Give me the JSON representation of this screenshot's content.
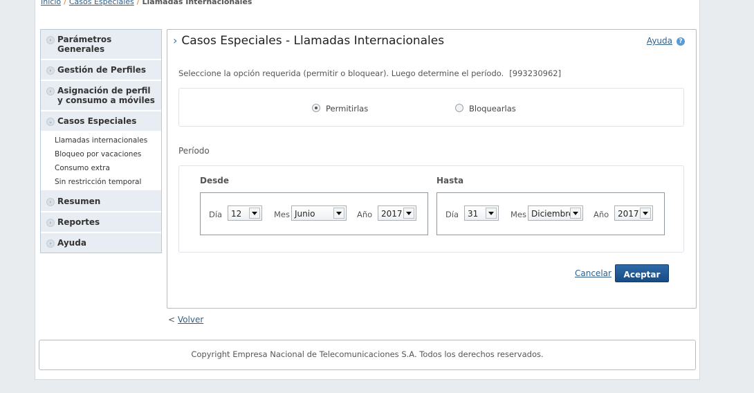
{
  "breadcrumb": {
    "home": "Inicio",
    "section": "Casos Especiales",
    "current": "Llamadas Internacionales"
  },
  "sidebar": {
    "items": [
      {
        "label": "Parámetros Generales"
      },
      {
        "label": "Gestión de Perfiles"
      },
      {
        "label": "Asignación de perfil y consumo a móviles"
      },
      {
        "label": "Casos Especiales"
      },
      {
        "label": "Resumen"
      },
      {
        "label": "Reportes"
      },
      {
        "label": "Ayuda"
      }
    ],
    "sub_items": [
      {
        "label": "Llamadas internacionales"
      },
      {
        "label": "Bloqueo por vacaciones"
      },
      {
        "label": "Consumo extra"
      },
      {
        "label": "Sin restricción temporal"
      }
    ]
  },
  "main": {
    "title": "Casos Especiales - Llamadas Internacionales",
    "help_label": "Ayuda",
    "instruction": "Seleccione la opción requerida (permitir o bloquear). Luego determine el período.",
    "number": "[993230962]",
    "options": {
      "allow": "Permitirlas",
      "block": "Bloquearlas",
      "selected": "Permitirlas"
    },
    "period_label": "Período",
    "from": {
      "title": "Desde",
      "day_label": "Día",
      "day": "12",
      "month_label": "Mes",
      "month": "Junio",
      "year_label": "Año",
      "year": "2017"
    },
    "to": {
      "title": "Hasta",
      "day_label": "Día",
      "day": "31",
      "month_label": "Mes",
      "month": "Diciembre",
      "year_label": "Año",
      "year": "2017"
    },
    "cancel_label": "Cancelar",
    "accept_label": "Aceptar"
  },
  "back": {
    "prefix": "<",
    "label": "Volver"
  },
  "footer": {
    "text": "Copyright Empresa Nacional de Telecomunicaciones S.A. Todos los derechos reservados."
  },
  "colors": {
    "accent": "#2d5f8b",
    "button": "#174c86",
    "sidebar_bg": "#e7edf3",
    "separator": "#e07a2a"
  }
}
